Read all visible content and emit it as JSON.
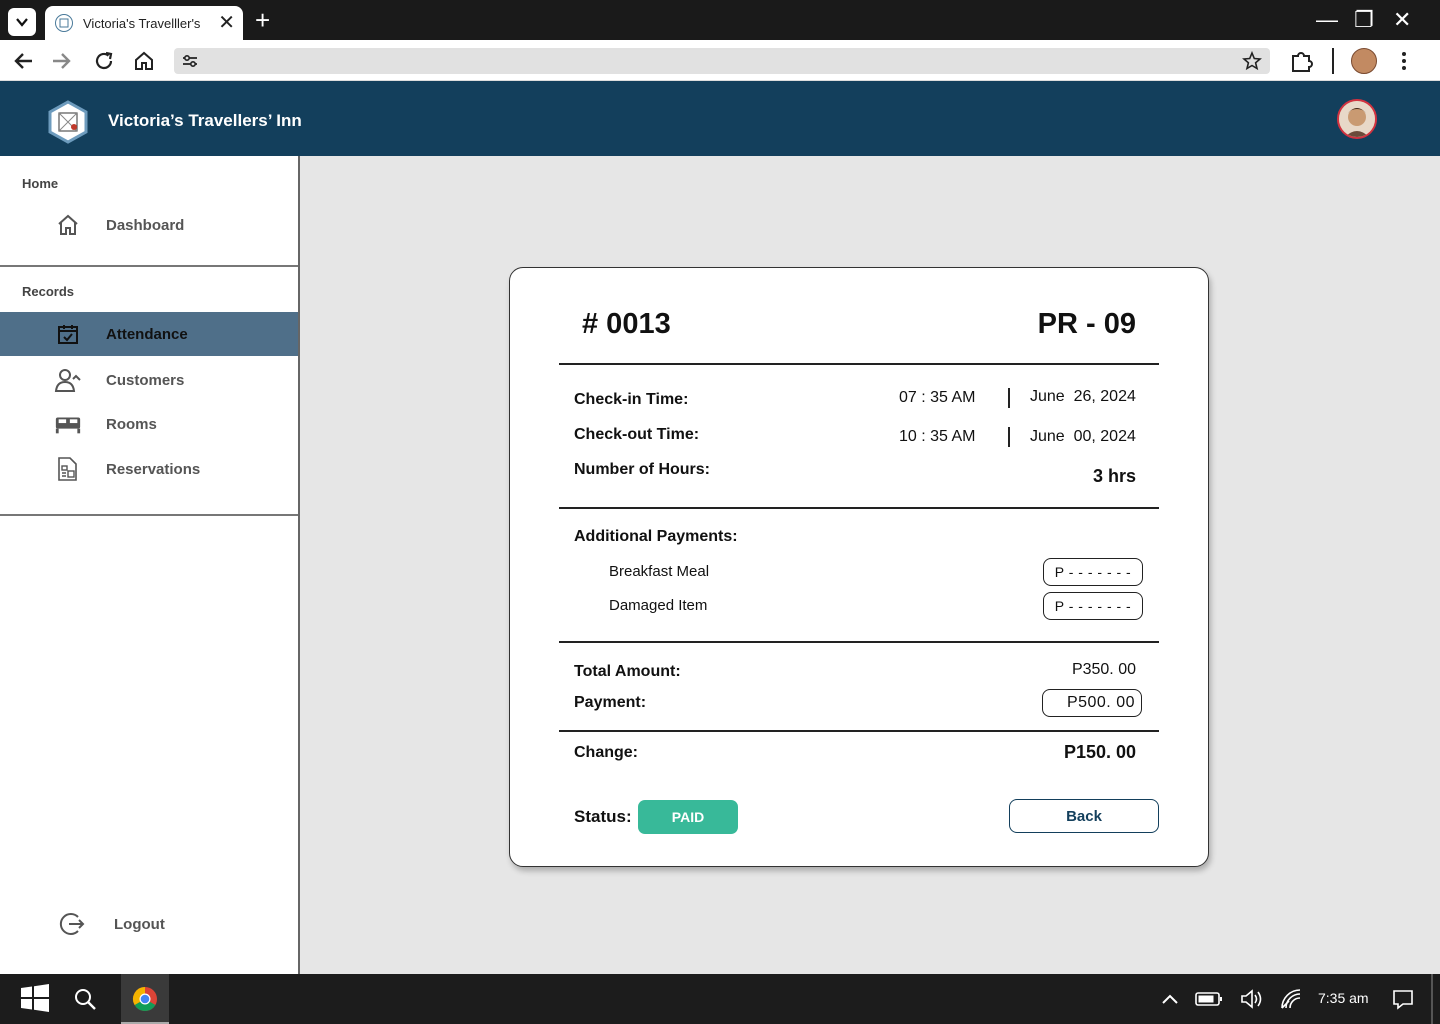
{
  "browser": {
    "tab_title": "Victoria's Travelller's",
    "new_tab": "+",
    "minimize": "—",
    "restore": "❐",
    "close": "✕"
  },
  "app": {
    "title": "Victoria’s Travellers’ Inn"
  },
  "sidebar": {
    "section_home": "Home",
    "section_records": "Records",
    "items": [
      {
        "label": "Dashboard",
        "icon": "home-icon"
      },
      {
        "label": "Attendance",
        "icon": "calendar-check-icon"
      },
      {
        "label": "Customers",
        "icon": "customers-icon"
      },
      {
        "label": "Rooms",
        "icon": "bed-icon"
      },
      {
        "label": "Reservations",
        "icon": "reservations-icon"
      }
    ],
    "logout": "Logout"
  },
  "receipt": {
    "number": "# 0013",
    "room": "PR - 09",
    "checkin_label": "Check-in Time:",
    "checkin_time": "07 : 35 AM",
    "checkin_date": "June  26, 2024",
    "checkout_label": "Check-out Time:",
    "checkout_time": "10 : 35 AM",
    "checkout_date": "June  00, 2024",
    "hours_label": "Number of Hours:",
    "hours_value": "3 hrs",
    "additional_label": "Additional Payments:",
    "breakfast_label": "Breakfast Meal",
    "breakfast_value": "P - - - - - - -",
    "damaged_label": "Damaged Item",
    "damaged_value": "P - - - - - - -",
    "total_label": "Total Amount:",
    "total_value": "P350. 00",
    "payment_label": "Payment:",
    "payment_value": "P500. 00",
    "change_label": "Change:",
    "change_value": "P150. 00",
    "status_label": "Status:",
    "status_value": "PAID",
    "back_label": "Back"
  },
  "taskbar": {
    "clock": "7:35 am"
  },
  "colors": {
    "header": "#133f5c",
    "active_item": "#4f6f89",
    "paid": "#38b999"
  }
}
